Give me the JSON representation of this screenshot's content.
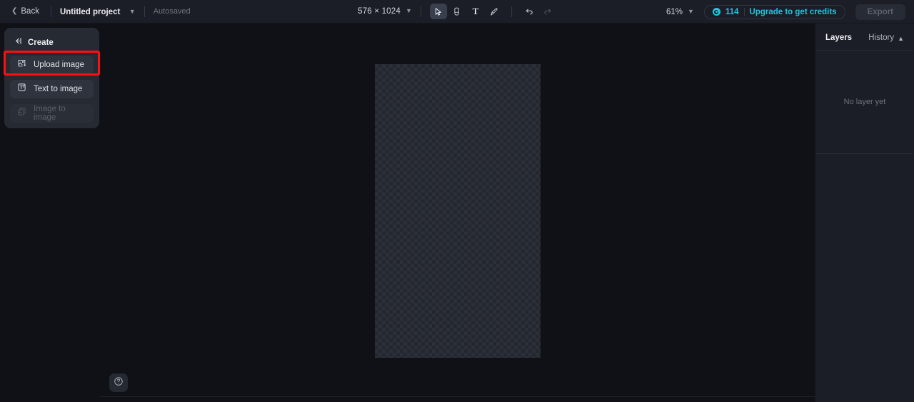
{
  "header": {
    "back_label": "Back",
    "back_icon": "chevron-left-icon",
    "project_name": "Untitled project",
    "project_chevron_icon": "chevron-down-icon",
    "autosaved_label": "Autosaved",
    "canvas_dimensions": "576 × 1024",
    "dimensions_chevron_icon": "chevron-down-icon",
    "tools": [
      {
        "name": "select-tool",
        "icon": "cursor-arrow-icon",
        "active": true
      },
      {
        "name": "eraser-tool",
        "icon": "eraser-icon",
        "active": false
      },
      {
        "name": "text-tool",
        "icon": "text-T-icon",
        "label": "T",
        "active": false
      },
      {
        "name": "brush-tool",
        "icon": "paint-brush-icon",
        "active": false
      }
    ],
    "undo_icon": "undo-arrow-icon",
    "redo_icon": "redo-arrow-icon",
    "zoom_level": "61%",
    "zoom_chevron_icon": "chevron-down-icon",
    "credits_icon": "coin-icon",
    "credits_count": "114",
    "upgrade_label": "Upgrade to get credits",
    "export_label": "Export"
  },
  "left_panel": {
    "collapse_icon": "collapse-panel-left-icon",
    "title": "Create",
    "items": [
      {
        "label": "Upload image",
        "icon": "image-upload-icon",
        "disabled": false,
        "highlighted": true
      },
      {
        "label": "Text to image",
        "icon": "text-to-image-icon",
        "disabled": false,
        "highlighted": false
      },
      {
        "label": "Image to image",
        "icon": "image-to-image-icon",
        "disabled": true,
        "highlighted": false
      }
    ]
  },
  "canvas": {
    "artboard_name": "transparent-artboard",
    "help_icon": "help-circle-icon"
  },
  "right_panel": {
    "title": "Layers",
    "history_label": "History",
    "history_chevron_icon": "chevron-up-icon",
    "empty_text": "No layer yet"
  },
  "colors": {
    "accent": "#1fc5de",
    "highlight_box": "#ff1010",
    "header_bg": "#1b1e26",
    "panel_bg": "#262a33",
    "canvas_bg": "#0f1116"
  }
}
